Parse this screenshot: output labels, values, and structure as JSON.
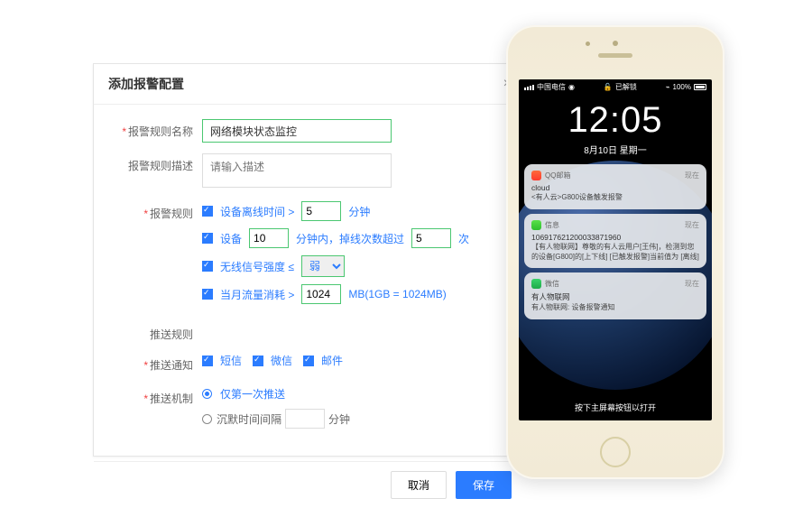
{
  "dialog": {
    "title": "添加报警配置",
    "labels": {
      "rule_name": "报警规则名称",
      "rule_desc": "报警规则描述",
      "rules": "报警规则",
      "push_rules": "推送规则",
      "push_notify": "推送通知",
      "push_mech": "推送机制"
    },
    "rule_name_value": "网络模块状态监控",
    "rule_desc_placeholder": "请输入描述",
    "rule1": {
      "cb_label": "设备离线时间 >",
      "value": "5",
      "unit": "分钟"
    },
    "rule2": {
      "cb_label": "设备",
      "value": "10",
      "text1": "分钟内，掉线次数超过",
      "value2": "5",
      "unit": "次"
    },
    "rule3": {
      "cb_label": "无线信号强度 ≤",
      "value": "弱"
    },
    "rule4": {
      "cb_label": "当月流量消耗 >",
      "value": "1024",
      "unit": "MB(1GB = 1024MB)"
    },
    "push": {
      "sms": "短信",
      "wechat": "微信",
      "email": "邮件"
    },
    "mech": {
      "once": "仅第一次推送",
      "silence": "沉默时间间隔",
      "unit": "分钟"
    },
    "buttons": {
      "cancel": "取消",
      "save": "保存"
    }
  },
  "phone": {
    "status": {
      "carrier": "中国电信",
      "wifi": "",
      "lock": "已解锁",
      "batt": "100%"
    },
    "clock": "12:05",
    "date": "8月10日 星期一",
    "n1": {
      "app": "QQ邮箱",
      "time": "现在",
      "title": "cloud",
      "body": "<有人云>G800设备触发报警"
    },
    "n2": {
      "app": "信息",
      "time": "现在",
      "title": "106917621200033871960",
      "body": "【有人物联网】尊敬的有人云用户[王伟]，检测到您的设备[G800]的[上下线] [已触发报警]当前值为 [离线]"
    },
    "n3": {
      "app": "微信",
      "time": "现在",
      "title": "有人物联网",
      "body": "有人物联网: 设备报警通知"
    },
    "unlock": "按下主屏幕按钮以打开"
  }
}
